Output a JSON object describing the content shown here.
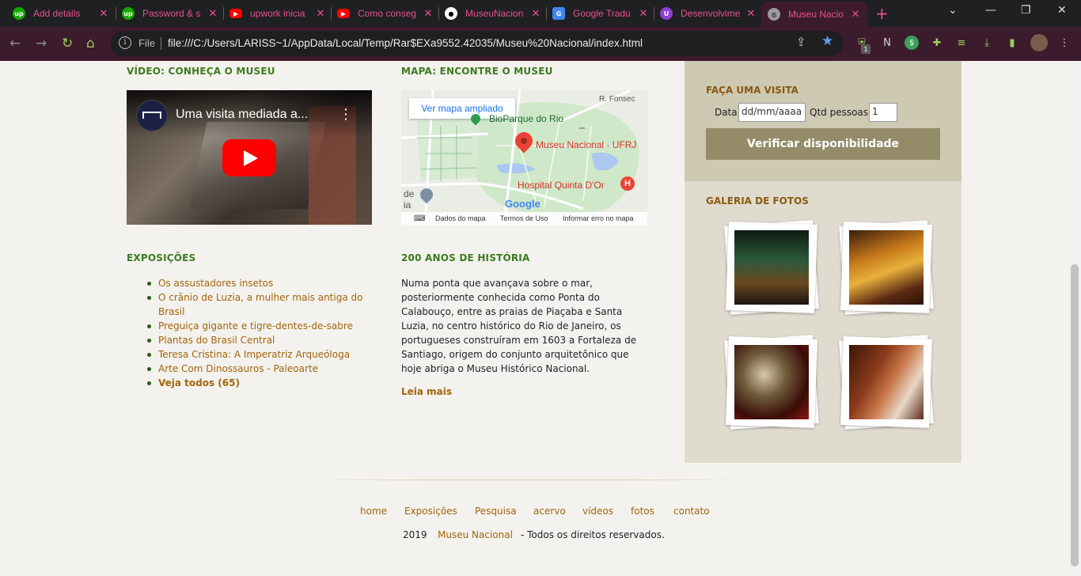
{
  "browser": {
    "tabs": [
      {
        "title": "Add details",
        "icon": "upwork-icon"
      },
      {
        "title": "Password & s",
        "icon": "upwork-icon"
      },
      {
        "title": "upwork inicia",
        "icon": "youtube-icon"
      },
      {
        "title": "Como conseg",
        "icon": "youtube-icon"
      },
      {
        "title": "MuseuNacion",
        "icon": "github-icon"
      },
      {
        "title": "Google Tradu",
        "icon": "google-translate-icon"
      },
      {
        "title": "Desenvolvime",
        "icon": "unknown-icon"
      },
      {
        "title": "Museu Nacio",
        "icon": "globe-icon"
      }
    ],
    "file_label": "File",
    "url": "file:///C:/Users/LARISS~1/AppData/Local/Temp/Rar$EXa9552.42035/Museu%20Nacional/index.html",
    "ext_badge": "1",
    "accent_color": "#e8508f"
  },
  "video": {
    "section_title": "VÍDEO: CONHEÇA O MUSEU",
    "video_title": "Uma visita mediada a..."
  },
  "map": {
    "section_title": "MAPA: ENCONTRE O MUSEU",
    "expand_button": "Ver mapa ampliado",
    "label_road": "R. Fonsec",
    "label_park": "BioParque do Rio",
    "label_museum": "Museu Nacional - UFRJ",
    "label_hospital": "Hospital Quinta D'Or",
    "label_de": "de",
    "label_ia": "ia",
    "google": "Google",
    "footer_data": "Dados do mapa",
    "footer_terms": "Termos de Uso",
    "footer_error": "Informar erro no mapa"
  },
  "exposicoes": {
    "section_title": "EXPOSIÇÕES",
    "items": [
      "Os assustadores insetos",
      "O crânio de Luzia, a mulher mais antiga do Brasil",
      "Preguiça gigante e tigre-dentes-de-sabre",
      "Plantas do Brasil Central",
      "Teresa Cristina: A Imperatriz Arqueóloga",
      "Arte Com Dinossauros - Paleoarte"
    ],
    "see_all": "Veja todos (65)"
  },
  "historia": {
    "section_title": "200 ANOS DE HISTÓRIA",
    "text": "Numa ponta que avançava sobre o mar, posteriormente conhecida como Ponta do Calabouço, entre as praias de Piaçaba e Santa Luzia, no centro histórico do Rio de Janeiro, os portugueses construíram em 1603 a Fortaleza de Santiago, origem do conjunto arquitetônico que hoje abriga o Museu Histórico Nacional.",
    "read_more": "Leia mais"
  },
  "visita": {
    "section_title": "FAÇA UMA VISITA",
    "date_label": "Data",
    "date_placeholder": "dd/mm/aaaa",
    "people_label": "Qtd pessoas",
    "people_value": "1",
    "button": "Verificar disponibilidade"
  },
  "galeria": {
    "section_title": "GALERIA DE FOTOS"
  },
  "footer": {
    "nav": [
      "home",
      "Exposições",
      "Pesquisa",
      "acervo",
      "vídeos",
      "fotos",
      "contato"
    ],
    "year": "2019",
    "brand": "Museu Nacional",
    "rights": "- Todos os direitos reservados."
  }
}
